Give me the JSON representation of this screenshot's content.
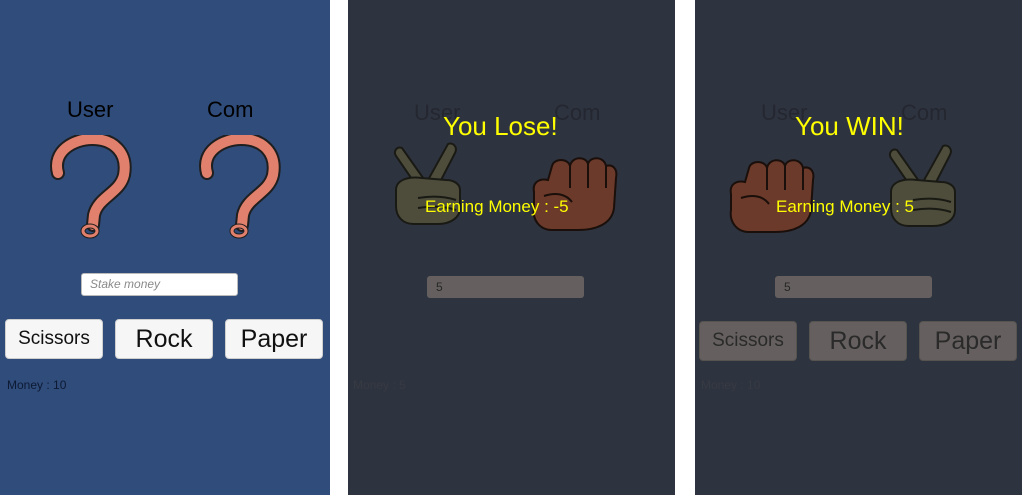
{
  "screens": [
    {
      "labels": {
        "user": "User",
        "com": "Com"
      },
      "stake_input": {
        "placeholder": "Stake money"
      },
      "buttons": {
        "scissors": "Scissors",
        "rock": "Rock",
        "paper": "Paper"
      },
      "money_text": "Money  : 10",
      "icons": [
        "question-mark-icon",
        "question-mark-icon"
      ]
    },
    {
      "labels": {
        "user": "User",
        "com": "Com"
      },
      "result_title": "You Lose!",
      "earning_text": "Earning Money : -5",
      "stake_value": "5",
      "money_text": "Money  : 5",
      "icons": [
        "scissors-hand-icon",
        "rock-fist-icon"
      ]
    },
    {
      "labels": {
        "user": "User",
        "com": "Com"
      },
      "result_title": "You WIN!",
      "earning_text": "Earning Money : 5",
      "stake_value": "5",
      "buttons": {
        "scissors": "Scissors",
        "rock": "Rock",
        "paper": "Paper"
      },
      "money_text": "Money  : 10",
      "icons": [
        "rock-fist-icon",
        "scissors-hand-icon"
      ]
    }
  ],
  "colors": {
    "panel_blue": "#2f4c7b",
    "panel_dark": "#2e3340",
    "question_mark": "#e1806c",
    "result_text": "#ffff00",
    "fist": "#6b3a2a",
    "scissors_hand": "#4e4d3c"
  }
}
